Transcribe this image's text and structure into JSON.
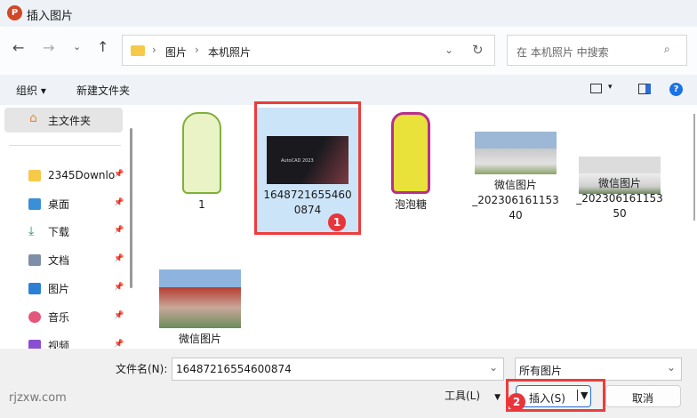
{
  "title": "插入图片",
  "nav": {
    "breadcrumb": [
      "图片",
      "本机照片"
    ],
    "search_placeholder": "在 本机照片 中搜索"
  },
  "toolbar": {
    "organize": "组织",
    "new_folder": "新建文件夹"
  },
  "sidebar": {
    "home": "主文件夹",
    "items": [
      {
        "label": "2345Downlo",
        "pinned": true
      },
      {
        "label": "桌面",
        "pinned": true
      },
      {
        "label": "下载",
        "pinned": true
      },
      {
        "label": "文档",
        "pinned": true
      },
      {
        "label": "图片",
        "pinned": true
      },
      {
        "label": "音乐",
        "pinned": true
      },
      {
        "label": "视频",
        "pinned": true
      }
    ]
  },
  "files": [
    {
      "name": "1"
    },
    {
      "name": "1648721655460\n0874",
      "selected": true,
      "thumb_text": "AutoCAD 2023"
    },
    {
      "name": "泡泡糖"
    },
    {
      "name": "微信图片\n_202306161153\n40"
    },
    {
      "name": "微信图片\n_202306161153\n50"
    },
    {
      "name": "微信图片"
    }
  ],
  "bottom": {
    "filename_label": "文件名(N):",
    "filename_value": "16487216554600874",
    "filter": "所有图片",
    "tools": "工具(L)",
    "insert": "插入(S)",
    "cancel": "取消",
    "watermark": "rjzxw.com"
  },
  "annotations": {
    "step1": "1",
    "step2": "2"
  }
}
